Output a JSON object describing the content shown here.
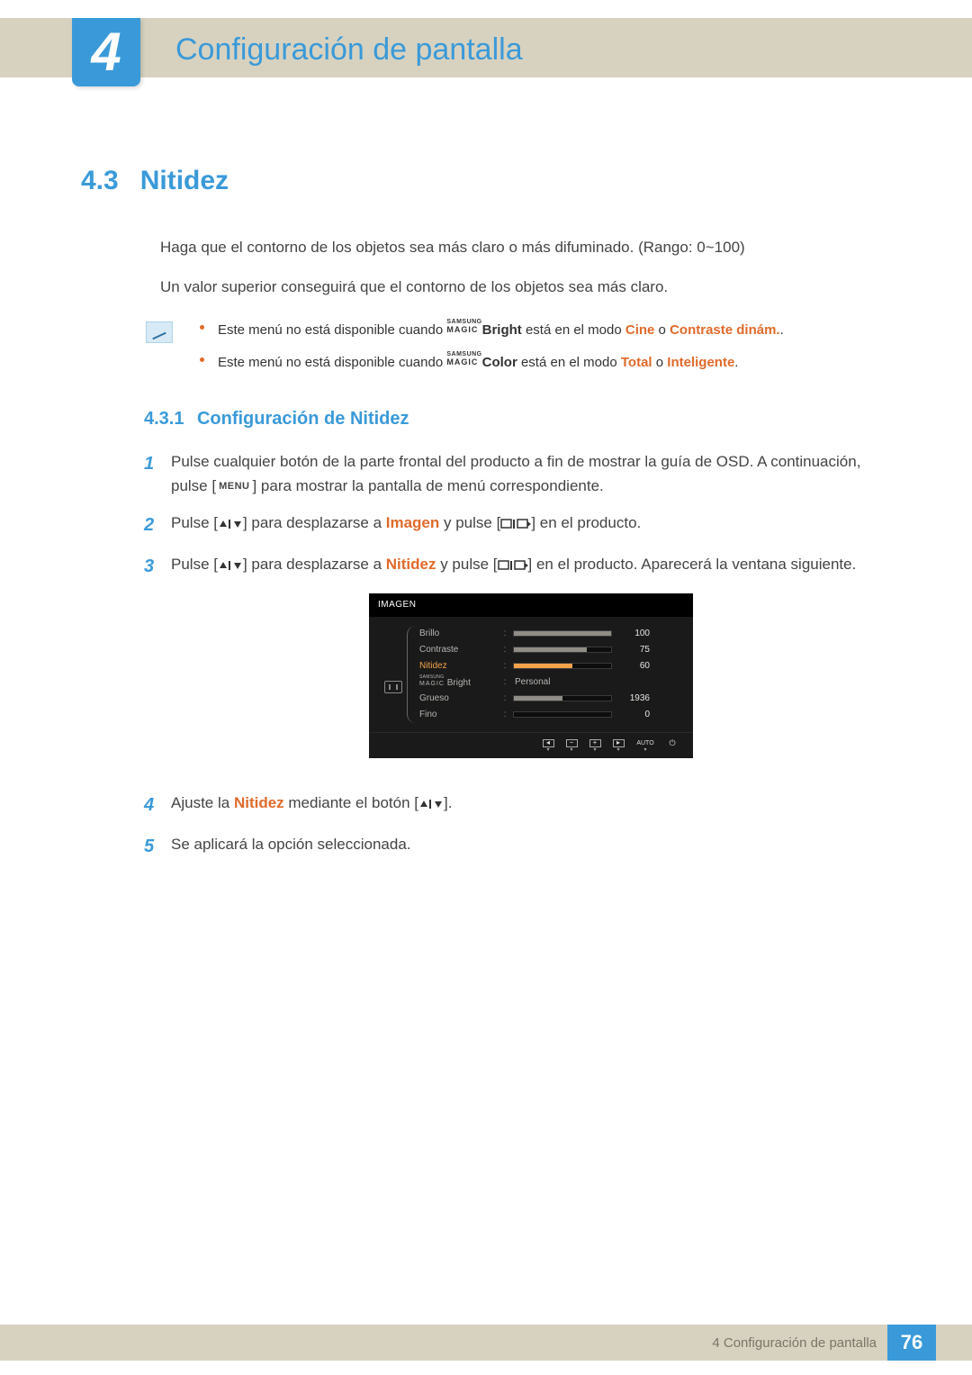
{
  "header": {
    "chapter_number": "4",
    "chapter_title": "Configuración de pantalla"
  },
  "section": {
    "number": "4.3",
    "title": "Nitidez",
    "intro_1": "Haga que el contorno de los objetos sea más claro o más difuminado. (Rango: 0~100)",
    "intro_2": "Un valor superior conseguirá que el contorno de los objetos sea más claro."
  },
  "notes": {
    "n1_pre": "Este menú no está disponible cuando ",
    "n1_magic_top": "SAMSUNG",
    "n1_magic_bottom": "MAGIC",
    "n1_suffix": "Bright",
    "n1_mid": " está en el modo ",
    "n1_hl1": "Cine",
    "n1_or": " o ",
    "n1_hl2": "Contraste dinám.",
    "n1_end": ".",
    "n2_pre": "Este menú no está disponible cuando ",
    "n2_magic_top": "SAMSUNG",
    "n2_magic_bottom": "MAGIC",
    "n2_suffix": "Color",
    "n2_mid": " está en el modo ",
    "n2_hl1": "Total",
    "n2_or": " o ",
    "n2_hl2": "Inteligente",
    "n2_end": "."
  },
  "subsection": {
    "number": "4.3.1",
    "title": "Configuración de Nitidez"
  },
  "steps": {
    "s1_a": "Pulse cualquier botón de la parte frontal del producto a fin de mostrar la guía de OSD. A continuación, pulse [",
    "s1_menu": "MENU",
    "s1_b": "] para mostrar la pantalla de menú correspondiente.",
    "s2_a": "Pulse [",
    "s2_b": "] para desplazarse a ",
    "s2_hl": "Imagen",
    "s2_c": " y pulse [",
    "s2_d": "] en el producto.",
    "s3_a": "Pulse [",
    "s3_b": "] para desplazarse a ",
    "s3_hl": "Nitidez",
    "s3_c": " y pulse [",
    "s3_d": "] en el producto. Aparecerá la ventana siguiente.",
    "s4_a": "Ajuste la ",
    "s4_hl": "Nitidez",
    "s4_b": " mediante el botón [",
    "s4_c": "].",
    "s5": "Se aplicará la opción seleccionada."
  },
  "osd": {
    "title": "IMAGEN",
    "rows": [
      {
        "label": "Brillo",
        "value": 100,
        "fill": 100,
        "type": "bar"
      },
      {
        "label": "Contraste",
        "value": 75,
        "fill": 75,
        "type": "bar"
      },
      {
        "label": "Nitidez",
        "value": 60,
        "fill": 60,
        "type": "bar",
        "active": true
      },
      {
        "label_magic_top": "SAMSUNG",
        "label_magic_bottom": "MAGIC",
        "label_suffix": " Bright",
        "text": "Personal",
        "type": "text"
      },
      {
        "label": "Grueso",
        "value": 1936,
        "fill": 50,
        "type": "bar"
      },
      {
        "label": "Fino",
        "value": 0,
        "fill": 0,
        "type": "bar"
      }
    ],
    "footer_auto": "AUTO"
  },
  "footer": {
    "text": "4 Configuración de pantalla",
    "page": "76"
  }
}
